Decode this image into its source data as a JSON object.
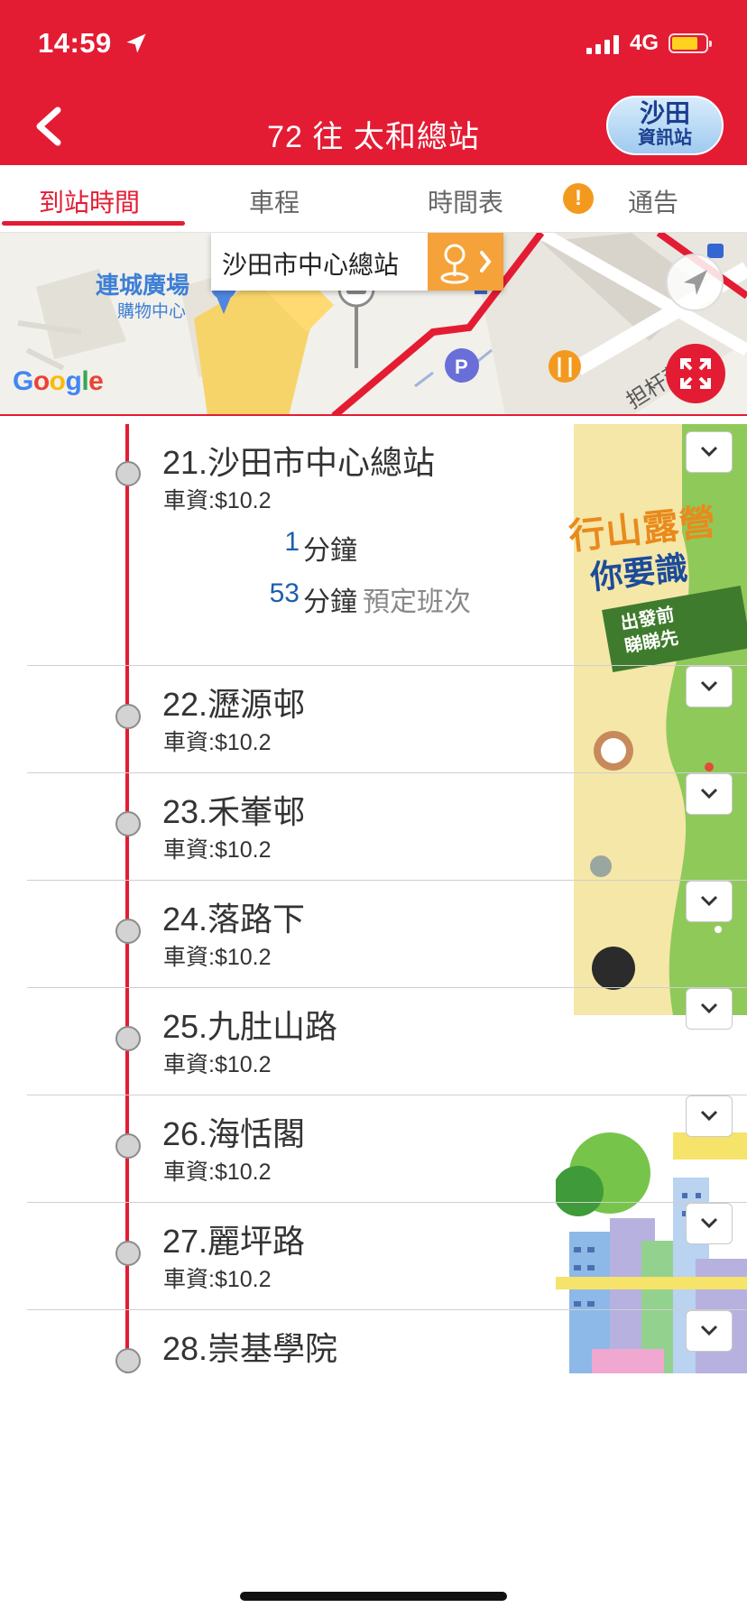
{
  "status_bar": {
    "time": "14:59",
    "network": "4G"
  },
  "header": {
    "title": "72 往 太和總站",
    "badge_line1": "沙田",
    "badge_line2": "資訊站"
  },
  "tabs": [
    {
      "label": "到站時間",
      "active": true
    },
    {
      "label": "車程"
    },
    {
      "label": "時間表"
    },
    {
      "label": "通告"
    }
  ],
  "map": {
    "mall_label": "連城廣場",
    "mall_sublabel": "購物中心",
    "road_label": "担杆莆",
    "callout": "沙田市中心總站",
    "google_logo": "Google"
  },
  "ad": {
    "headline1": "行山露營",
    "headline2": "你要識",
    "cta_line1": "出發前",
    "cta_line2": "睇睇先"
  },
  "stops": [
    {
      "name": "21.沙田市中心總站",
      "fare": "車資:$10.2",
      "etas": [
        {
          "minutes": "1",
          "unit": "分鐘",
          "note": ""
        },
        {
          "minutes": "53",
          "unit": "分鐘",
          "note": "預定班次"
        }
      ]
    },
    {
      "name": "22.瀝源邨",
      "fare": "車資:$10.2"
    },
    {
      "name": "23.禾輋邨",
      "fare": "車資:$10.2"
    },
    {
      "name": "24.落路下",
      "fare": "車資:$10.2"
    },
    {
      "name": "25.九肚山路",
      "fare": "車資:$10.2"
    },
    {
      "name": "26.海恬閣",
      "fare": "車資:$10.2"
    },
    {
      "name": "27.麗坪路",
      "fare": "車資:$10.2"
    },
    {
      "name": "28.崇基學院",
      "fare": ""
    }
  ],
  "colors": {
    "brand_red": "#e31c34",
    "eta_blue": "#1d5fad",
    "callout_orange": "#f6a23a"
  },
  "icons": [
    "location-arrow-icon",
    "signal-icon",
    "battery-icon",
    "back-chevron-icon",
    "warning-icon",
    "bus-stop-pin-icon",
    "compass-icon",
    "expand-icon",
    "chevron-down-icon",
    "parking-icon",
    "restaurant-icon"
  ]
}
